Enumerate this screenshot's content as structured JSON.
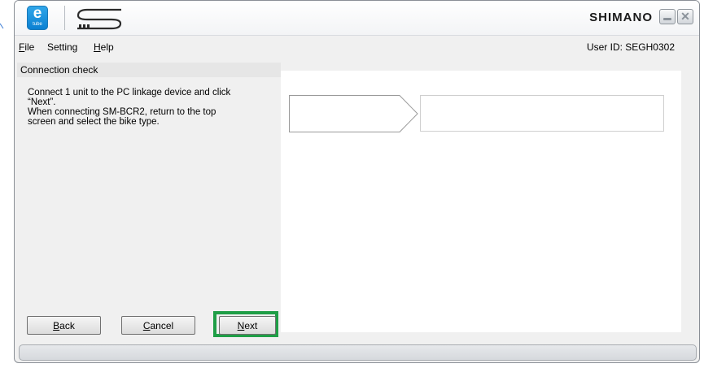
{
  "app": {
    "icon_letter": "e",
    "icon_caption": "tube",
    "brand": "SHIMANO"
  },
  "menu": {
    "items": [
      {
        "label": "File",
        "mnemonic": "F",
        "rest": "ile"
      },
      {
        "label": "Setting",
        "mnemonic": "",
        "rest": "Setting"
      },
      {
        "label": "Help",
        "mnemonic": "H",
        "rest": "elp"
      }
    ],
    "user_id": "User ID: SEGH0302"
  },
  "left_panel": {
    "header": "Connection check",
    "instruction_lines": [
      "Connect 1 unit to the PC linkage device and click",
      "“Next”.",
      "When connecting SM-BCR2, return to the top",
      "screen and select the bike type."
    ]
  },
  "buttons": {
    "back": {
      "mnemonic": "B",
      "rest": "ack"
    },
    "cancel": {
      "mnemonic": "C",
      "rest": "ancel"
    },
    "next": {
      "mnemonic": "N",
      "rest": "ext"
    }
  },
  "colors": {
    "highlight": "#1f9e46",
    "accent": "#0a7fd1"
  },
  "icons": [
    "etube-app-icon",
    "shimano-s-logo",
    "minimize-icon",
    "close-icon"
  ]
}
